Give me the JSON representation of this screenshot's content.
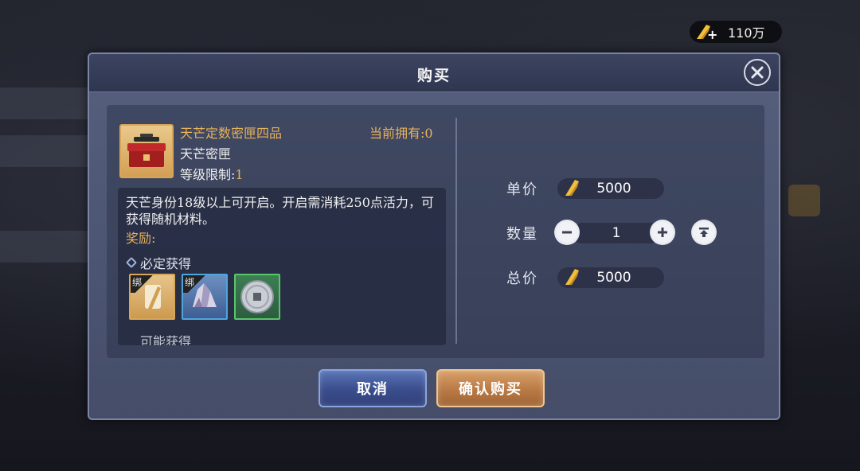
{
  "currency": {
    "icon": "gold-quill-icon",
    "value": "110万"
  },
  "dialog": {
    "title": "购买",
    "close_icon": "close-icon"
  },
  "item": {
    "name": "天芒定数密匣四品",
    "type": "天芒密匣",
    "level_label": "等级限制:",
    "level_value": "1",
    "owned_label": "当前拥有:",
    "owned_value": "0",
    "description": "天芒身份18级以上可开启。开启需消耗250点活力，可获得随机材料。",
    "reward_label": "奖励:",
    "guaranteed_label": "必定获得",
    "rewards": [
      {
        "name": "reward-item-1",
        "tag": "绑",
        "border": "#d7a658"
      },
      {
        "name": "reward-item-2",
        "tag": "绑",
        "border": "#4fa6dc"
      },
      {
        "name": "reward-item-3",
        "tag": "",
        "border": "#58c56a"
      }
    ],
    "next_section_partial": "可能获得"
  },
  "purchase": {
    "unit_price_label": "单价",
    "unit_price": "5000",
    "quantity_label": "数量",
    "quantity": "1",
    "total_label": "总价",
    "total_price": "5000",
    "price_icon": "gold-quill-icon"
  },
  "buttons": {
    "cancel": "取消",
    "confirm": "确认购买"
  },
  "colors": {
    "accent_gold": "#e6b25d",
    "cancel_blue": "#3a4d8c",
    "confirm_orange": "#b97a45"
  }
}
